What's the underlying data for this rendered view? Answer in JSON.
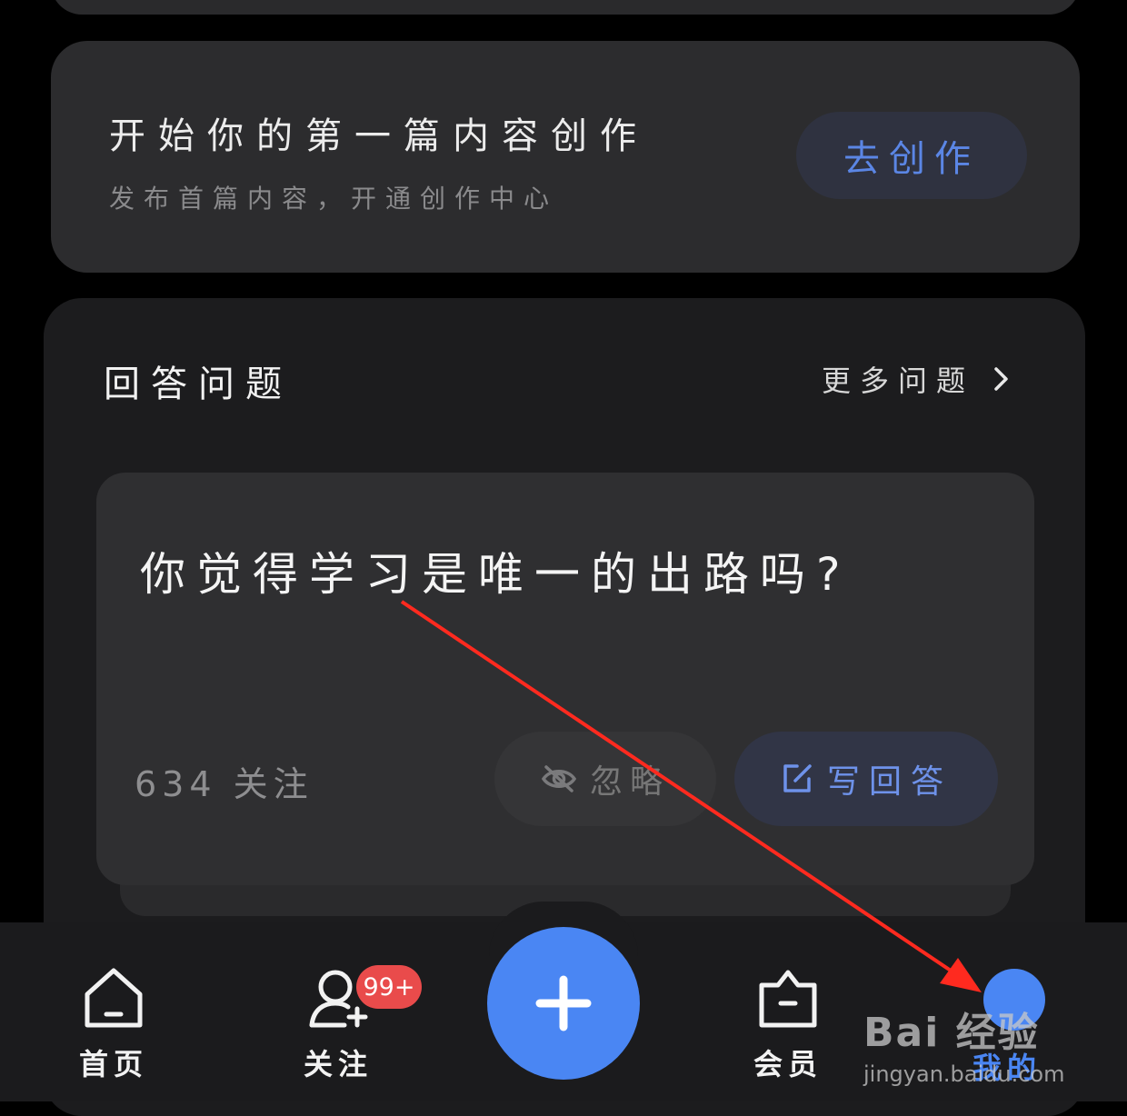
{
  "create_card": {
    "title": "开始你的第一篇内容创作",
    "subtitle": "发布首篇内容，开通创作中心",
    "button_label": "去创作"
  },
  "answer_section": {
    "title": "回答问题",
    "more_label": "更多问题",
    "question": {
      "text": "你觉得学习是唯一的出路吗?",
      "followers": "634 关注",
      "ignore_label": "忽略",
      "write_label": "写回答"
    }
  },
  "bottom_nav": {
    "home_label": "首页",
    "follow_label": "关注",
    "follow_badge": "99+",
    "member_label": "会员",
    "me_label": "我的"
  },
  "watermark": {
    "top": "Bai 经验",
    "bottom": "jingyan.baidu.com"
  },
  "colors": {
    "accent": "#4a86f3",
    "badge": "#e94b4b",
    "annotation_arrow": "#ff2a1f"
  }
}
